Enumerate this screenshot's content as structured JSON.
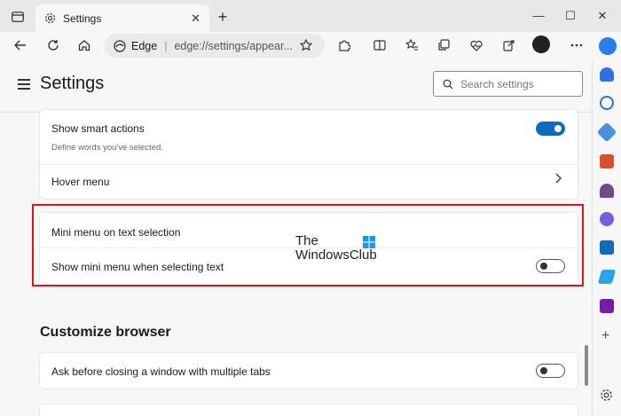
{
  "tab": {
    "title": "Settings",
    "close": "✕"
  },
  "new_tab": "+",
  "window_controls": {
    "minimize": "—",
    "maximize": "☐",
    "close": "✕"
  },
  "address": {
    "brand": "Edge",
    "url": "edge://settings/appear..."
  },
  "page": {
    "title": "Settings",
    "search_placeholder": "Search settings"
  },
  "cards": {
    "smart": {
      "show_smart_actions": {
        "title": "Show smart actions",
        "subtitle": "Define words you've selected.",
        "toggle": "on"
      },
      "hover_menu": {
        "title": "Hover menu"
      }
    },
    "mini_menu": {
      "heading": "Mini menu on text selection",
      "show_mini_menu": {
        "title": "Show mini menu when selecting text",
        "toggle": "off"
      }
    },
    "customize": {
      "heading": "Customize browser",
      "ask_before_closing": {
        "title": "Ask before closing a window with multiple tabs",
        "toggle": "off"
      }
    }
  },
  "watermark": {
    "line1": "The",
    "line2": "WindowsClub"
  },
  "colors": {
    "accent": "#0f6cbd",
    "highlight": "#e0141e"
  },
  "sidebar_icons": [
    "bell-icon",
    "search-icon",
    "tag-icon",
    "toolbox-icon",
    "chess-icon",
    "copilot-icon",
    "outlook-icon",
    "send-icon",
    "onenote-icon",
    "add-icon",
    "settings-icon"
  ]
}
